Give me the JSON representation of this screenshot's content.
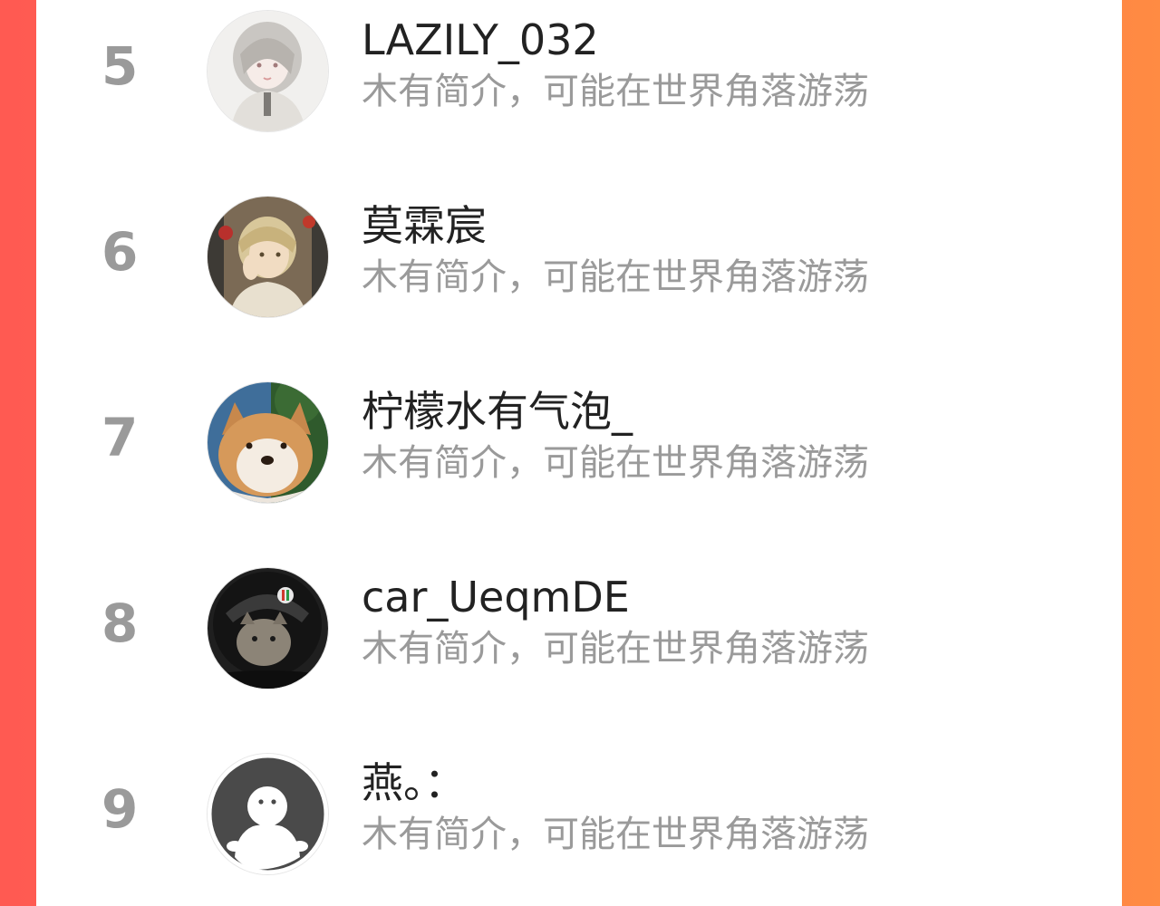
{
  "colors": {
    "background_left": "#ff5a52",
    "background_right": "#ff8b43",
    "panel": "#ffffff",
    "rank_text": "#9a9a9a",
    "name_text": "#222222",
    "bio_text": "#9a9a9a"
  },
  "ranking": {
    "items": [
      {
        "rank": "5",
        "name": "LAZILY_032",
        "bio": "木有简介，可能在世界角落游荡",
        "avatar_icon": "anime-girl-avatar"
      },
      {
        "rank": "6",
        "name": "莫霖宸",
        "bio": "木有简介，可能在世界角落游荡",
        "avatar_icon": "anime-boy-avatar"
      },
      {
        "rank": "7",
        "name": "柠檬水有气泡_",
        "bio": "木有简介，可能在世界角落游荡",
        "avatar_icon": "shiba-dog-avatar"
      },
      {
        "rank": "8",
        "name": "car_UeqmDE",
        "bio": "木有简介，可能在世界角落游荡",
        "avatar_icon": "cat-helmet-avatar"
      },
      {
        "rank": "9",
        "name": "燕。：",
        "bio": "木有简介，可能在世界角落游荡",
        "avatar_icon": "default-user-avatar"
      }
    ]
  }
}
